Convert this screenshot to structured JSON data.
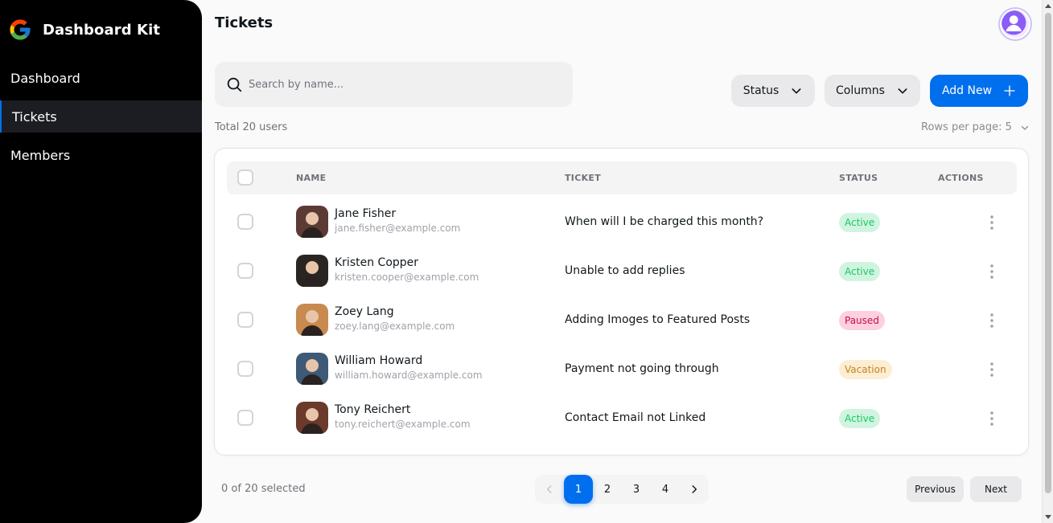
{
  "brand": {
    "name": "Dashboard Kit",
    "logo_icon": "google-g-logo-icon"
  },
  "sidebar": {
    "items": [
      {
        "label": "Dashboard",
        "active": false
      },
      {
        "label": "Tickets",
        "active": true
      },
      {
        "label": "Members",
        "active": false
      }
    ]
  },
  "header": {
    "title": "Tickets",
    "avatar_icon": "user-avatar-icon"
  },
  "search": {
    "placeholder": "Search by name...",
    "value": ""
  },
  "toolbar": {
    "status_label": "Status",
    "columns_label": "Columns",
    "add_label": "Add New",
    "accent_color": "#006fee"
  },
  "summary": {
    "total_text": "Total 20 users",
    "rows_per_page_label": "Rows per page:",
    "rows_per_page_value": "5"
  },
  "table": {
    "columns": [
      "NAME",
      "TICKET",
      "STATUS",
      "ACTIONS"
    ],
    "rows": [
      {
        "name": "Jane Fisher",
        "email": "jane.fisher@example.com",
        "ticket": "When will I be charged this month?",
        "status": "Active",
        "status_kind": "active",
        "avatar_color": "#5b3b34"
      },
      {
        "name": "Kristen Copper",
        "email": "kristen.cooper@example.com",
        "ticket": "Unable to add replies",
        "status": "Active",
        "status_kind": "active",
        "avatar_color": "#2b2522"
      },
      {
        "name": "Zoey Lang",
        "email": "zoey.lang@example.com",
        "ticket": "Adding Imoges to Featured Posts",
        "status": "Paused",
        "status_kind": "paused",
        "avatar_color": "#c88a4e"
      },
      {
        "name": "William Howard",
        "email": "william.howard@example.com",
        "ticket": "Payment not going through",
        "status": "Vacation",
        "status_kind": "vacation",
        "avatar_color": "#3e5a76"
      },
      {
        "name": "Tony Reichert",
        "email": "tony.reichert@example.com",
        "ticket": "Contact Email not Linked",
        "status": "Active",
        "status_kind": "active",
        "avatar_color": "#6b3a2a"
      }
    ]
  },
  "footer": {
    "selected_text": "0 of 20 selected",
    "pages": [
      "1",
      "2",
      "3",
      "4"
    ],
    "current_page": "1",
    "previous_label": "Previous",
    "next_label": "Next"
  }
}
